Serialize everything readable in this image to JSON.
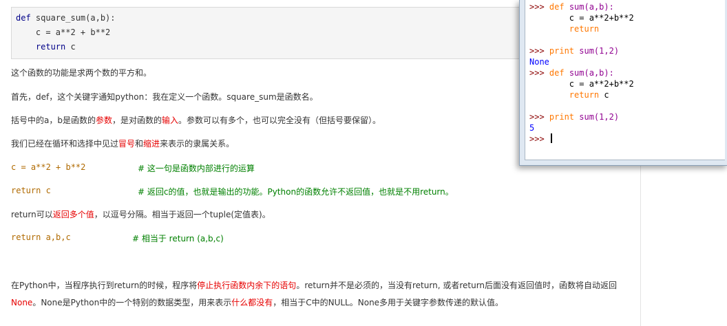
{
  "codebox": {
    "line1_kw": "def",
    "line1_rest": " square_sum(a,b):",
    "line2": "    c = a**2 + b**2",
    "line3_kw": "    return",
    "line3_rest": " c"
  },
  "text": {
    "p1": "这个函数的功能是求两个数的平方和。",
    "p2_a": "首先，def，这个关键字通知python：我在定义一个函数。square_sum是函数名。",
    "p3_a": "括号中的a，b是函数的",
    "p3_red1": "参数",
    "p3_b": "，是对函数的",
    "p3_red2": "输入",
    "p3_c": "。参数可以有多个，也可以完全没有（但括号要保留）。",
    "p4_a": "我们已经在循环和选择中见过",
    "p4_red1": "冒号",
    "p4_b": "和",
    "p4_red2": "缩进",
    "p4_c": "来表示的隶属关系。",
    "code1": "c = a**2 + b**2",
    "code1_comment": "# 这一句是函数内部进行的运算",
    "code2": "return c",
    "code2_comment": "# 返回c的值，也就是输出的功能。Python的函数允许不返回值，也就是不用return。",
    "p5_a": "return可以",
    "p5_red": "返回多个值",
    "p5_b": "，以逗号分隔。相当于返回一个tuple(定值表)。",
    "code3": "return a,b,c",
    "code3_comment": "# 相当于 return (a,b,c)",
    "p6_a": "在Python中，当程序执行到return的时候，程序将",
    "p6_red1": "停止执行函数内余下的语句",
    "p6_b": "。return并不是必须的，当没有return, 或者return后面没有返回值时，函数将自动返回",
    "p6_red2": "None",
    "p6_c": "。None是Python中的一个特别的数据类型，用来表示",
    "p6_red3": "什么都没有",
    "p6_d": "，相当于C中的NULL。None多用于关键字参数传递的默认值。"
  },
  "shell": {
    "prompt": ">>> ",
    "l1_kw": "def",
    "l1_rest": " sum(a,b):",
    "l2": "        c = a**2+b**2",
    "l3_kw": "        return",
    "l5_kw": "print",
    "l5_rest": " sum(1,2)",
    "l6_out": "None",
    "l7_kw": "def",
    "l7_rest": " sum(a,b):",
    "l8": "        c = a**2+b**2",
    "l9_kw": "        return",
    "l9_rest": " c",
    "l11_kw": "print",
    "l11_rest": " sum(1,2)",
    "l12_out": "5"
  },
  "colors": {
    "accent_red": "#e60000",
    "comment_green": "#008000",
    "code_orange": "#b06a00",
    "shell_prompt": "#8b0000",
    "shell_keyword": "#ff7700",
    "shell_builtin": "#900090",
    "shell_output": "#0000ff"
  }
}
